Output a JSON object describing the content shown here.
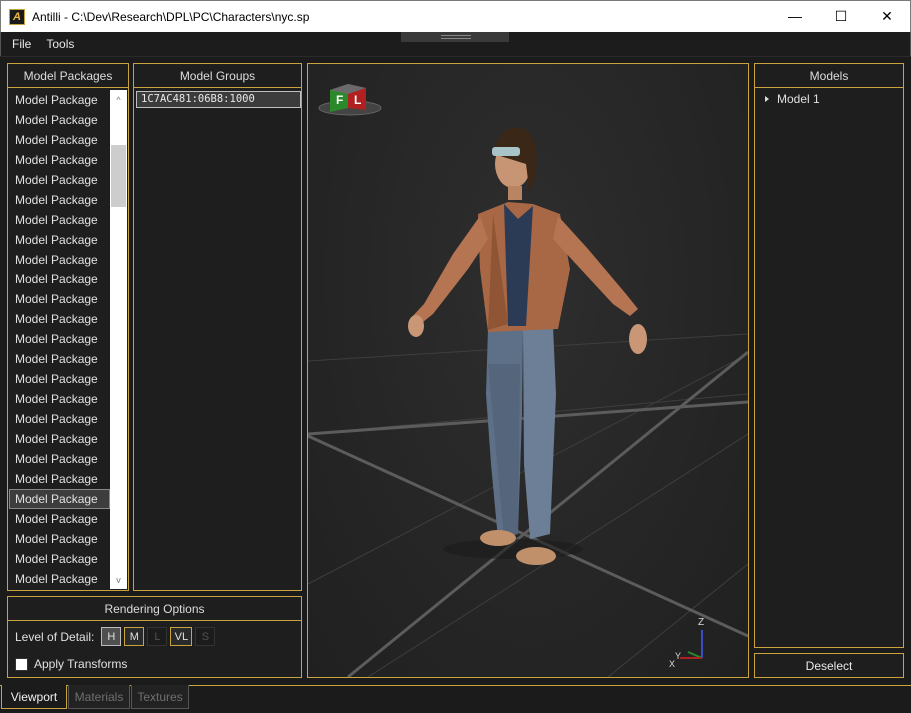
{
  "window": {
    "title": "Antilli - C:\\Dev\\Research\\DPL\\PC\\Characters\\nyc.sp",
    "app_icon": "A",
    "minimize_icon": "—",
    "maximize_icon": "☐",
    "close_icon": "✕"
  },
  "menu": {
    "file": "File",
    "tools": "Tools"
  },
  "model_packages": {
    "header": "Model Packages",
    "items": [
      "Model Package",
      "Model Package",
      "Model Package",
      "Model Package",
      "Model Package",
      "Model Package",
      "Model Package",
      "Model Package",
      "Model Package",
      "Model Package",
      "Model Package",
      "Model Package",
      "Model Package",
      "Model Package",
      "Model Package",
      "Model Package",
      "Model Package",
      "Model Package",
      "Model Package",
      "Model Package",
      "Model Package",
      "Model Package",
      "Model Package",
      "Model Package",
      "Model Package"
    ],
    "selected_index": 20,
    "scroll_up": "^",
    "scroll_down": "v"
  },
  "model_groups": {
    "header": "Model Groups",
    "items": [
      "1C7AC481:06B8:1000"
    ]
  },
  "rendering_options": {
    "header": "Rendering Options",
    "lod_label": "Level of Detail:",
    "lod": {
      "h": "H",
      "m": "M",
      "l": "L",
      "vl": "VL",
      "s": "S"
    },
    "apply_transforms": "Apply Transforms"
  },
  "viewport": {
    "cube_front": "F",
    "cube_left": "L",
    "axis_z": "Z",
    "axis_y": "Y",
    "axis_x": "X"
  },
  "models": {
    "header": "Models",
    "items": [
      "Model 1"
    ],
    "deselect": "Deselect"
  },
  "tabs": {
    "viewport": "Viewport",
    "materials": "Materials",
    "textures": "Textures"
  },
  "colors": {
    "accent": "#c9a43e",
    "background": "#1b1b1b",
    "panel": "#1e1e1e"
  }
}
